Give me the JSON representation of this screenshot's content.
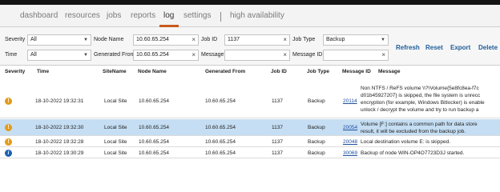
{
  "nav": {
    "items": [
      "dashboard",
      "resources",
      "jobs",
      "reports",
      "log",
      "settings",
      "high availability"
    ],
    "active": "log",
    "active_color": "#c95a1c"
  },
  "filters": {
    "severity_label": "Severity",
    "severity_value": "All",
    "node_name_label": "Node Name",
    "node_name_value": "10.60.65.254",
    "job_id_label": "Job ID",
    "job_id_value": "1137",
    "job_type_label": "Job Type",
    "job_type_value": "Backup",
    "time_label": "Time",
    "time_value": "All",
    "generated_from_label": "Generated From",
    "generated_from_value": "10.60.65.254",
    "message_label": "Message",
    "message_value": "",
    "message_id_label": "Message ID",
    "message_id_value": ""
  },
  "actions": {
    "refresh": "Refresh",
    "reset": "Reset",
    "export": "Export",
    "delete": "Delete"
  },
  "table": {
    "headers": [
      "Severity",
      "Time",
      "SiteName",
      "Node Name",
      "Generated From",
      "Job ID",
      "Job Type",
      "Message ID",
      "Message"
    ],
    "rows": [
      {
        "severity": "warning",
        "time": "18-10-2022 19:32:31",
        "site": "Local Site",
        "node": "10.60.65.254",
        "generated_from": "10.60.65.254",
        "job_id": "1137",
        "job_type": "Backup",
        "message_id": "20114",
        "message_lines": [
          "Non NTFS / ReFS volume \\\\?\\Volume{5e8fc8ea-f7c",
          "d01b45927207} is skipped, the file system is unrecc",
          "encryption (for example, Windows Bitlocker) is enable",
          "unlock / decrypt the volume and try to run backup a"
        ],
        "selected": false
      },
      {
        "severity": "warning",
        "time": "18-10-2022 19:32:30",
        "site": "Local Site",
        "node": "10.60.65.254",
        "generated_from": "10.60.65.254",
        "job_id": "1137",
        "job_type": "Backup",
        "message_id": "20054",
        "message_lines": [
          "Volume [F:] contains a common path for data store",
          "result, it will be excluded from the backup job."
        ],
        "selected": true
      },
      {
        "severity": "warning",
        "time": "18-10-2022 19:32:28",
        "site": "Local Site",
        "node": "10.60.65.254",
        "generated_from": "10.60.65.254",
        "job_id": "1137",
        "job_type": "Backup",
        "message_id": "20048",
        "message_lines": [
          "Local destination volume E: is skipped."
        ],
        "selected": false
      },
      {
        "severity": "info",
        "time": "18-10-2022 19:30:29",
        "site": "Local Site",
        "node": "10.60.65.254",
        "generated_from": "10.60.65.254",
        "job_id": "1137",
        "job_type": "Backup",
        "message_id": "30069",
        "message_lines": [
          "Backup of node WIN-OP4O7723D3J started."
        ],
        "selected": false
      }
    ]
  },
  "colors": {
    "link": "#1f4fa0",
    "action": "#1f5d9a",
    "selected_row": "#c5def3",
    "warning": "#e39b19",
    "info": "#1b5fb0"
  }
}
